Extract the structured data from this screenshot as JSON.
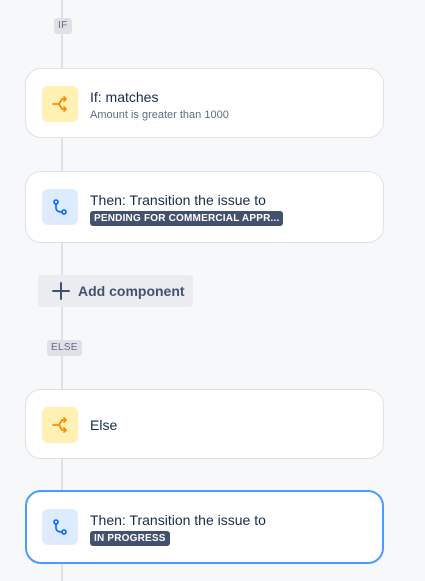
{
  "branches": {
    "if_label": "IF",
    "else_label": "ELSE"
  },
  "cards": {
    "condition": {
      "title": "If: matches",
      "subtitle": "Amount is greater than 1000",
      "icon": "branch-icon"
    },
    "action_1": {
      "title": "Then: Transition the issue to",
      "status": "PENDING FOR COMMERCIAL APPR...",
      "icon": "transition-icon"
    },
    "else": {
      "title": "Else",
      "icon": "branch-icon"
    },
    "action_2": {
      "title": "Then: Transition the issue to",
      "status": "IN PROGRESS",
      "icon": "transition-icon"
    }
  },
  "add_component": {
    "label": "Add component"
  },
  "colors": {
    "condition_icon_bg": "#fff0b3",
    "condition_icon_fg": "#ff8b00",
    "action_icon_bg": "#deebff",
    "action_icon_fg": "#0065ff",
    "lozenge_bg": "#42526e",
    "selected_border": "#4c9aff"
  }
}
